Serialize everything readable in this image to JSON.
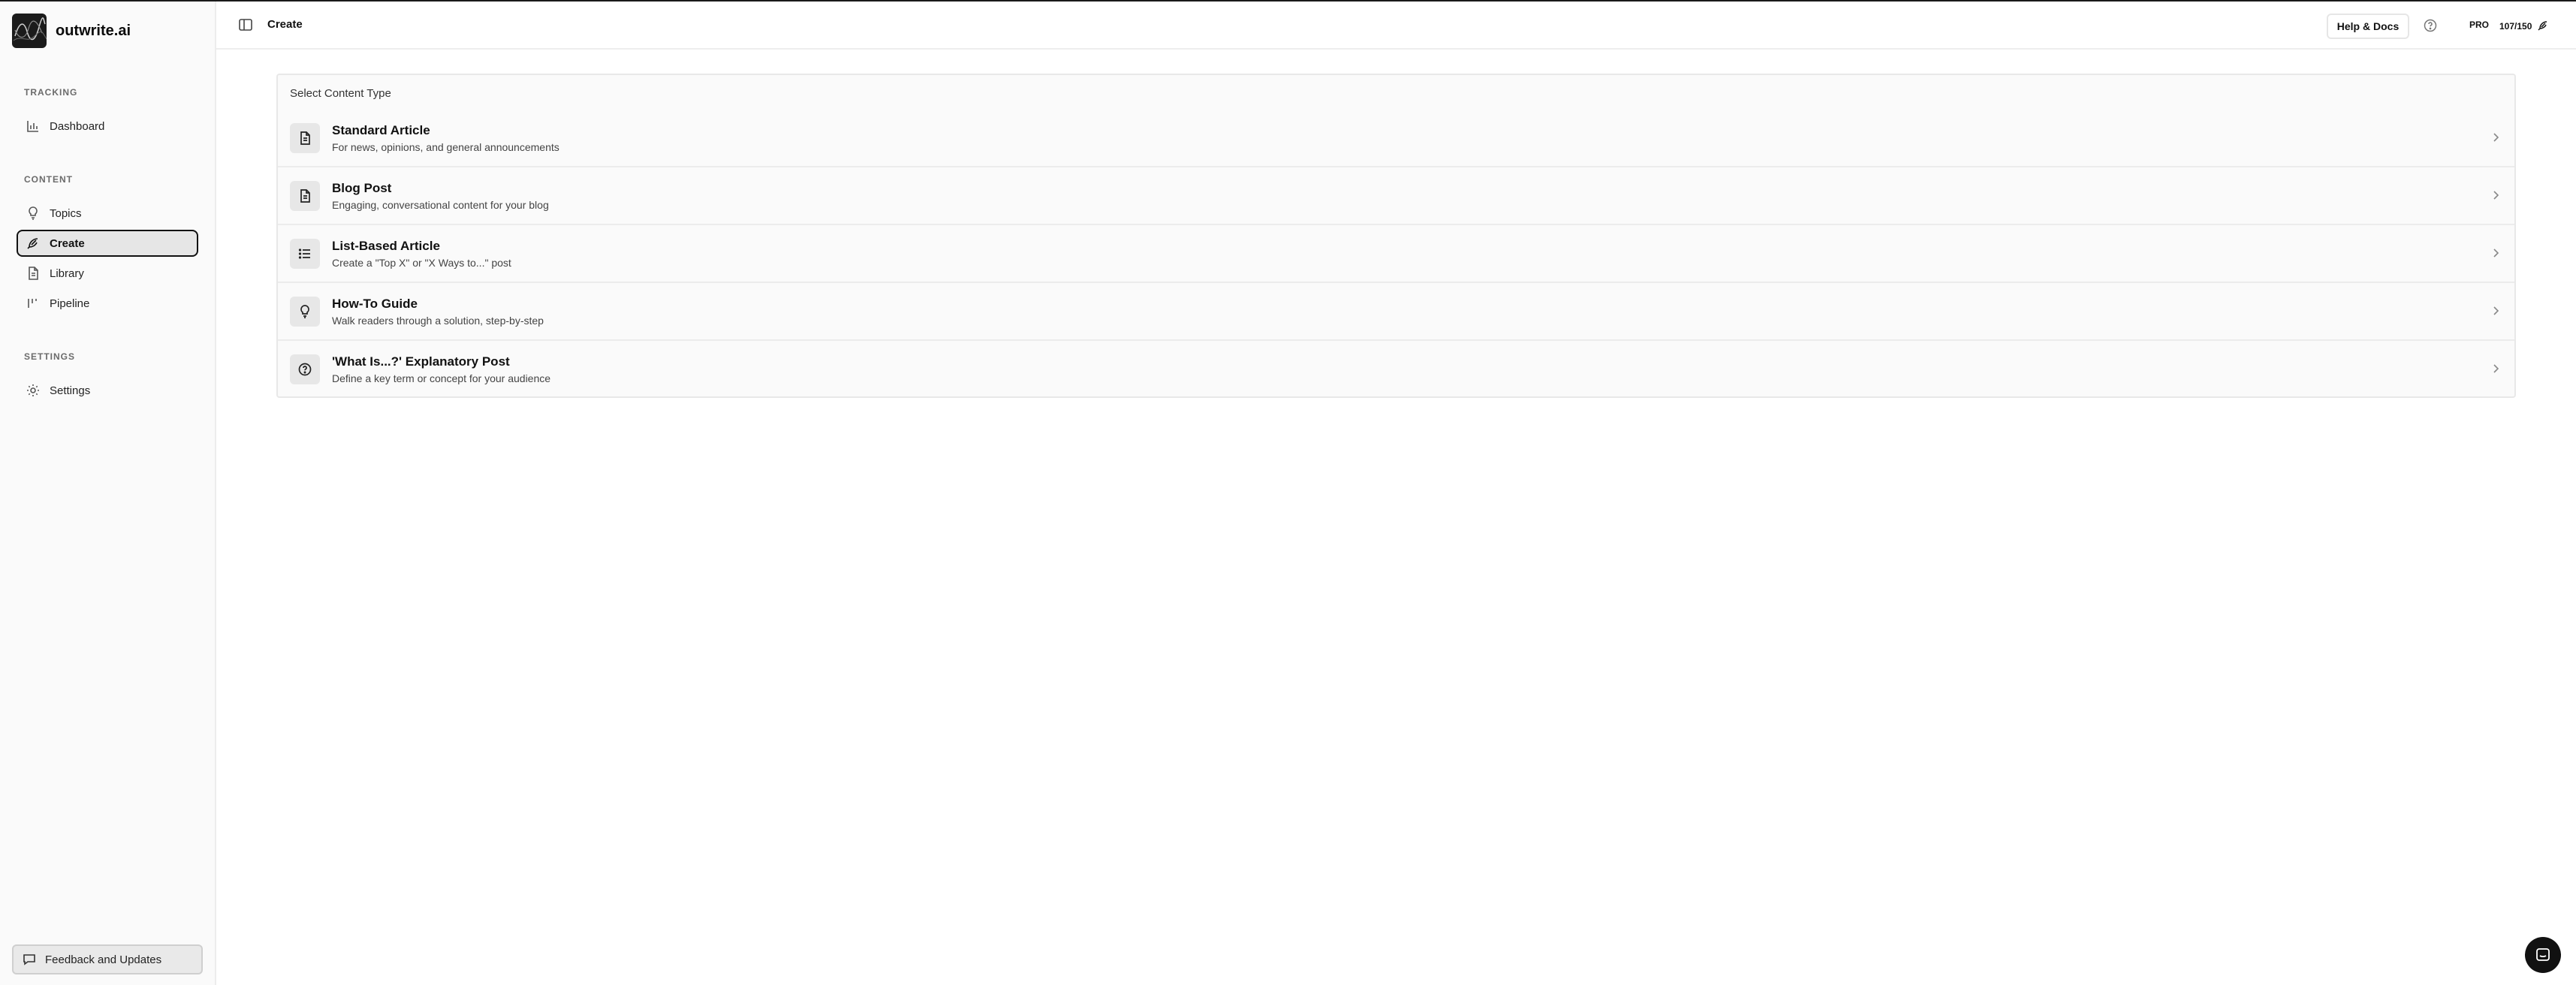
{
  "brand": {
    "name": "outwrite.ai"
  },
  "sidebar": {
    "sections": [
      {
        "label": "TRACKING"
      },
      {
        "label": "CONTENT"
      },
      {
        "label": "SETTINGS"
      }
    ],
    "items": [
      {
        "label": "Dashboard",
        "icon": "chart-icon"
      },
      {
        "label": "Topics",
        "icon": "lightbulb-icon"
      },
      {
        "label": "Create",
        "icon": "feather-icon",
        "active": true
      },
      {
        "label": "Library",
        "icon": "document-icon"
      },
      {
        "label": "Pipeline",
        "icon": "pipeline-icon"
      },
      {
        "label": "Settings",
        "icon": "gear-icon"
      }
    ],
    "feedback_label": "Feedback and Updates"
  },
  "header": {
    "breadcrumb": "Create",
    "help_label": "Help & Docs",
    "plan": "PRO",
    "credits": "107/150"
  },
  "main": {
    "title": "Select Content Type",
    "types": [
      {
        "title": "Standard Article",
        "description": "For news, opinions, and general announcements",
        "icon": "document-icon"
      },
      {
        "title": "Blog Post",
        "description": "Engaging, conversational content for your blog",
        "icon": "document-icon"
      },
      {
        "title": "List-Based Article",
        "description": "Create a \"Top X\" or \"X Ways to...\" post",
        "icon": "list-icon"
      },
      {
        "title": "How-To Guide",
        "description": "Walk readers through a solution, step-by-step",
        "icon": "lightbulb-icon"
      },
      {
        "title": "'What Is...?' Explanatory Post",
        "description": "Define a key term or concept for your audience",
        "icon": "question-circle-icon"
      }
    ]
  },
  "colors": {
    "active_border": "#111111",
    "sidebar_bg": "#fafafa",
    "card_bg": "#fafafa"
  }
}
